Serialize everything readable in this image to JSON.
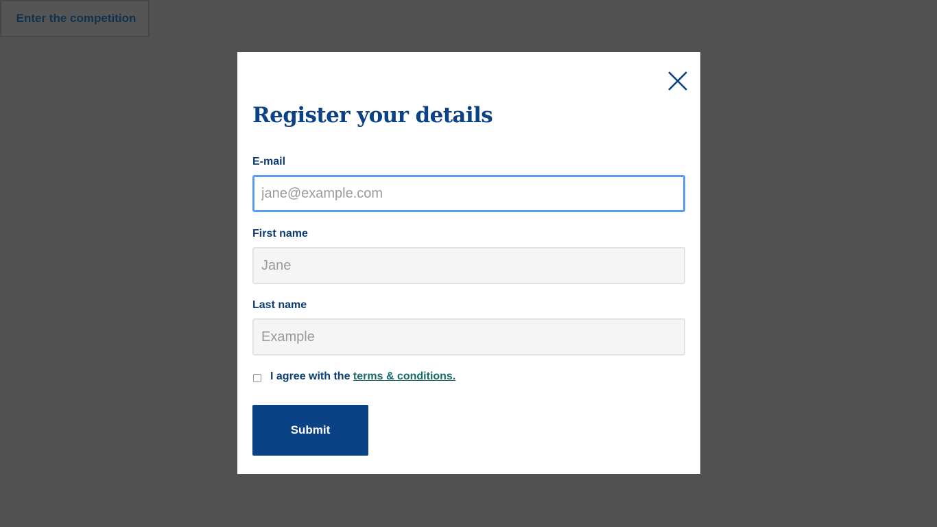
{
  "page": {
    "enter_button_label": "Enter the competition"
  },
  "modal": {
    "title": "Register your details",
    "close_icon": "close-icon",
    "fields": {
      "email": {
        "label": "E-mail",
        "placeholder": "jane@example.com",
        "value": ""
      },
      "first_name": {
        "label": "First name",
        "placeholder": "Jane",
        "value": ""
      },
      "last_name": {
        "label": "Last name",
        "placeholder": "Example",
        "value": ""
      }
    },
    "agree": {
      "prefix": "I agree with the ",
      "link_text": "terms & conditions.",
      "checked": false
    },
    "submit_label": "Submit"
  },
  "colors": {
    "overlay": "#515151",
    "brand_blue": "#0b4285",
    "focus_ring": "#5b9bf2",
    "link_teal": "#196b6a"
  }
}
